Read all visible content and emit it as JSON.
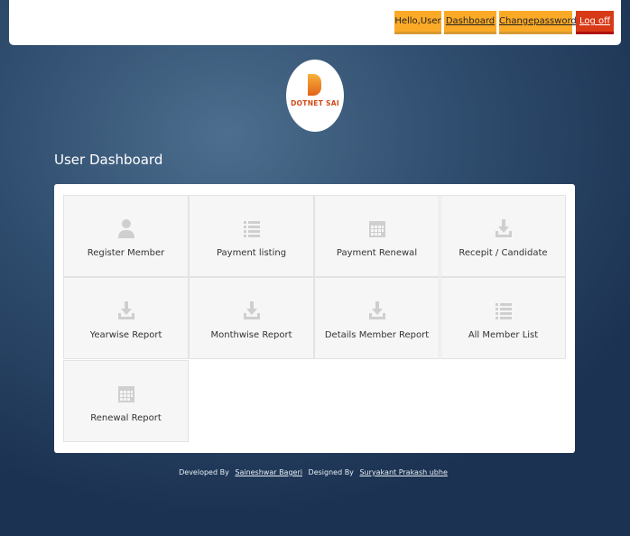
{
  "header": {
    "greeting": "Hello,User",
    "dashboard": "Dashboard",
    "change_password": "Changepassword",
    "logoff": "Log off"
  },
  "logo": {
    "text": "DOTNET SAI"
  },
  "page_title": "User Dashboard",
  "tiles": [
    {
      "label": "Register Member",
      "icon": "user-icon"
    },
    {
      "label": "Payment listing",
      "icon": "list-icon"
    },
    {
      "label": "Payment Renewal",
      "icon": "calendar-icon"
    },
    {
      "label": "Recepit / Candidate",
      "icon": "download-icon"
    },
    {
      "label": "Yearwise Report",
      "icon": "download-icon"
    },
    {
      "label": "Monthwise Report",
      "icon": "download-icon"
    },
    {
      "label": "Details Member Report",
      "icon": "download-icon"
    },
    {
      "label": "All Member List",
      "icon": "list-icon"
    },
    {
      "label": "Renewal Report",
      "icon": "calendar-icon"
    }
  ],
  "footer": {
    "developed_by": "Developed By",
    "developer": "Saineshwar Bageri",
    "designed_by": "Designed By",
    "designer": "Suryakant Prakash ubhe"
  }
}
